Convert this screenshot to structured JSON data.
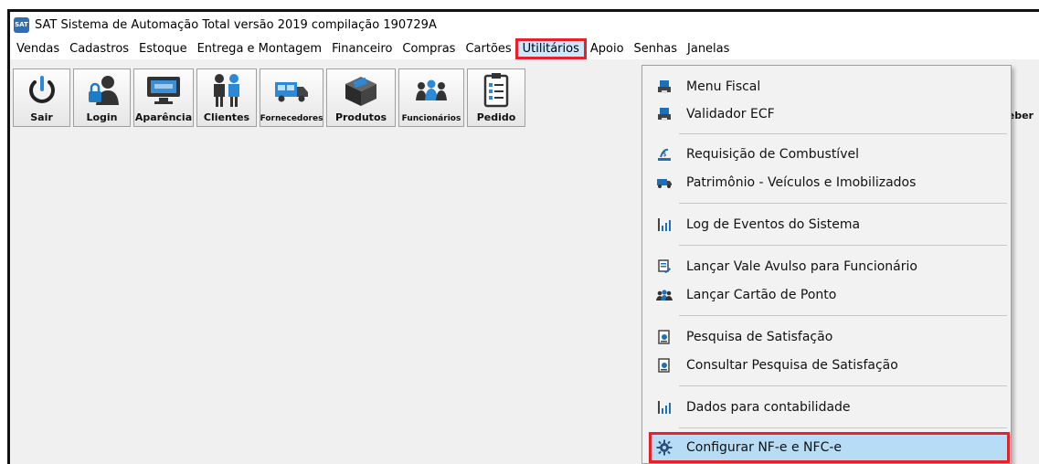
{
  "window": {
    "title": "SAT Sistema de Automação Total versão 2019 compilação 190729A",
    "app_icon": "sat-logo-icon"
  },
  "menubar": {
    "items": [
      {
        "label": "Vendas"
      },
      {
        "label": "Cadastros"
      },
      {
        "label": "Estoque"
      },
      {
        "label": "Entrega e Montagem"
      },
      {
        "label": "Financeiro"
      },
      {
        "label": "Compras"
      },
      {
        "label": "Cartões"
      },
      {
        "label": "Utilitários",
        "active": true
      },
      {
        "label": "Apoio"
      },
      {
        "label": "Senhas"
      },
      {
        "label": "Janelas"
      }
    ]
  },
  "toolbar": {
    "buttons": [
      {
        "label": "Sair",
        "icon": "power-icon"
      },
      {
        "label": "Login",
        "icon": "user-lock-icon"
      },
      {
        "label": "Aparência",
        "icon": "monitor-icon"
      },
      {
        "label": "Clientes",
        "icon": "clients-icon"
      },
      {
        "label": "Fornecedores",
        "icon": "truck-icon"
      },
      {
        "label": "Produtos",
        "icon": "box-icon"
      },
      {
        "label": "Funcionários",
        "icon": "employees-icon"
      },
      {
        "label": "Pedido",
        "icon": "order-icon"
      }
    ],
    "partial_right_label": "eber"
  },
  "dropdown": {
    "menu": "Utilitários",
    "items": [
      {
        "label": "Menu Fiscal",
        "icon": "fiscal-printer-icon"
      },
      {
        "label": "Validador ECF",
        "icon": "fiscal-printer-icon"
      },
      {
        "label": "Requisição de Combustível",
        "icon": "fuel-icon"
      },
      {
        "label": "Patrimônio - Veículos e Imobilizados",
        "icon": "vehicle-icon"
      },
      {
        "label": "Log de Eventos do Sistema",
        "icon": "bar-chart-icon"
      },
      {
        "label": "Lançar Vale Avulso para Funcionário",
        "icon": "voucher-icon"
      },
      {
        "label": "Lançar Cartão de Ponto",
        "icon": "people-icon"
      },
      {
        "label": "Pesquisa de Satisfação",
        "icon": "survey-icon"
      },
      {
        "label": "Consultar Pesquisa de Satisfação",
        "icon": "survey-icon"
      },
      {
        "label": "Dados para contabilidade",
        "icon": "bar-chart-icon"
      },
      {
        "label": "Configurar NF-e e NFC-e",
        "icon": "gear-icon",
        "highlighted": true
      }
    ]
  },
  "colors": {
    "highlight_border": "#e8202a",
    "selection": "#b7dcf5",
    "menu_active": "#cce8ff"
  }
}
